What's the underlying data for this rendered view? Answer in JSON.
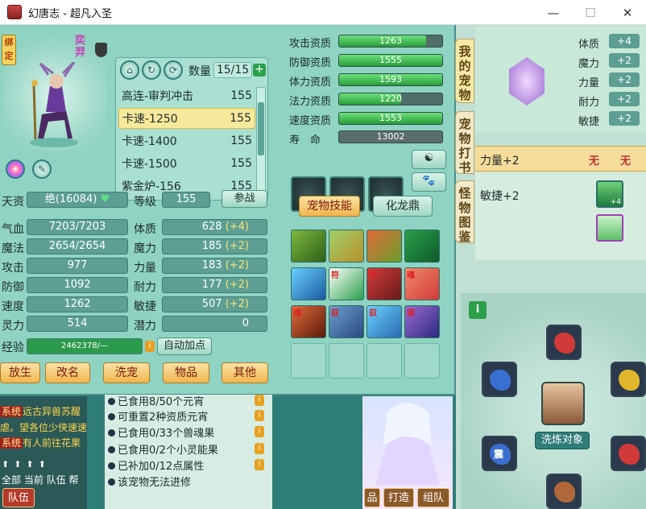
{
  "window": {
    "title": "幻唐志 - 超凡入圣",
    "minimize": "—",
    "maximize": "☐",
    "close": "✕"
  },
  "pet": {
    "name": "奕羿",
    "bind_tag": "绑定"
  },
  "list": {
    "count_label": "数量",
    "count_value": "15/15",
    "plus": "+",
    "rows": [
      {
        "name": "高连-审判冲击",
        "level": "155"
      },
      {
        "name": "卡速-1250",
        "level": "155"
      },
      {
        "name": "卡速-1400",
        "level": "155"
      },
      {
        "name": "卡速-1500",
        "level": "155"
      },
      {
        "name": "紫金炉-156",
        "level": "155"
      }
    ]
  },
  "stats": {
    "talent_label": "天资",
    "talent_value": "绝(16084)",
    "level_label": "等级",
    "level_value": "155",
    "battle_button": "参战",
    "rows": [
      {
        "label": "气血",
        "value": "7203/7203",
        "label2": "体质",
        "value2": "628",
        "bonus2": "(+4)"
      },
      {
        "label": "魔法",
        "value": "2654/2654",
        "label2": "魔力",
        "value2": "185",
        "bonus2": "(+2)"
      },
      {
        "label": "攻击",
        "value": "977",
        "label2": "力量",
        "value2": "183",
        "bonus2": "(+2)"
      },
      {
        "label": "防御",
        "value": "1092",
        "label2": "耐力",
        "value2": "177",
        "bonus2": "(+2)"
      },
      {
        "label": "速度",
        "value": "1262",
        "label2": "敏捷",
        "value2": "507",
        "bonus2": "(+2)"
      },
      {
        "label": "灵力",
        "value": "514",
        "label2": "潜力",
        "value2": "0",
        "bonus2": ""
      }
    ],
    "exp_label": "经验",
    "exp_value": "2462378/—",
    "exp_progress": 1.0,
    "auto_add": "自动加点"
  },
  "bottom_buttons": [
    "放生",
    "改名",
    "洗宠",
    "物品",
    "其他"
  ],
  "aptitude": {
    "rows": [
      {
        "label": "攻击资质",
        "value": "1263",
        "fill": 0.84
      },
      {
        "label": "防御资质",
        "value": "1555",
        "fill": 1.0
      },
      {
        "label": "体力资质",
        "value": "1593",
        "fill": 1.0
      },
      {
        "label": "法力资质",
        "value": "1220",
        "fill": 0.6
      },
      {
        "label": "速度资质",
        "value": "1553",
        "fill": 1.0
      }
    ],
    "life_label": "寿　命",
    "life_value": "13002"
  },
  "tabs": {
    "skills": "宠物技能",
    "dragon": "化龙鼎"
  },
  "skill_tags": [
    "",
    "",
    "",
    "",
    "",
    "符",
    "符",
    "魂",
    "魂",
    "驭",
    "驭",
    "骑"
  ],
  "side_tabs": [
    "我的宠物",
    "宠物打书",
    "怪物图鉴"
  ],
  "right_attrs": [
    {
      "label": "体质",
      "value": "+4"
    },
    {
      "label": "魔力",
      "value": "+2"
    },
    {
      "label": "力量",
      "value": "+2"
    },
    {
      "label": "耐力",
      "value": "+2"
    },
    {
      "label": "敏捷",
      "value": "+2"
    }
  ],
  "enhance": {
    "row1_label": "力量+2",
    "row1_a": "无",
    "row1_b": "无",
    "row2_label": "敏捷+2",
    "badge": "+4"
  },
  "wash": {
    "target": "洗炼对象",
    "seal": "震"
  },
  "chat": {
    "lines": [
      {
        "tag": "系统",
        "text": "远古异兽苏醒"
      },
      {
        "tag": "",
        "text": "虐。望各位少侠速速"
      },
      {
        "tag": "系统",
        "text": "有人前往花果"
      }
    ],
    "tabs": [
      "全部",
      "当前",
      "队伍",
      "帮"
    ],
    "team_button": "队伍"
  },
  "info_lines": [
    {
      "text": "已食用8/50个元宵"
    },
    {
      "text": "可重置2种资质元宵"
    },
    {
      "text": "已食用0/33个兽魂果"
    },
    {
      "text": "已食用0/2个小灵能果"
    },
    {
      "text": "已补加0/12点属性"
    },
    {
      "text": "该宠物无法进修"
    }
  ],
  "bottom_menu": [
    "品",
    "打造",
    "组队"
  ],
  "colors": {
    "accent": "#2aa04a",
    "panel": "#8fd3c3",
    "bonus": "#ffe37a"
  }
}
